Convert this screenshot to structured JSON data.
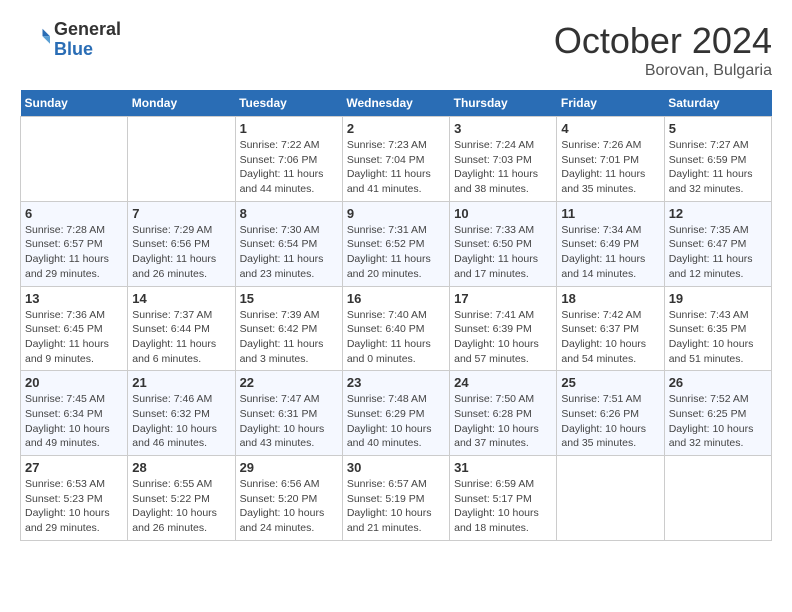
{
  "header": {
    "logo_general": "General",
    "logo_blue": "Blue",
    "month_title": "October 2024",
    "location": "Borovan, Bulgaria"
  },
  "weekdays": [
    "Sunday",
    "Monday",
    "Tuesday",
    "Wednesday",
    "Thursday",
    "Friday",
    "Saturday"
  ],
  "weeks": [
    [
      null,
      null,
      {
        "day": "1",
        "sunrise": "Sunrise: 7:22 AM",
        "sunset": "Sunset: 7:06 PM",
        "daylight": "Daylight: 11 hours and 44 minutes."
      },
      {
        "day": "2",
        "sunrise": "Sunrise: 7:23 AM",
        "sunset": "Sunset: 7:04 PM",
        "daylight": "Daylight: 11 hours and 41 minutes."
      },
      {
        "day": "3",
        "sunrise": "Sunrise: 7:24 AM",
        "sunset": "Sunset: 7:03 PM",
        "daylight": "Daylight: 11 hours and 38 minutes."
      },
      {
        "day": "4",
        "sunrise": "Sunrise: 7:26 AM",
        "sunset": "Sunset: 7:01 PM",
        "daylight": "Daylight: 11 hours and 35 minutes."
      },
      {
        "day": "5",
        "sunrise": "Sunrise: 7:27 AM",
        "sunset": "Sunset: 6:59 PM",
        "daylight": "Daylight: 11 hours and 32 minutes."
      }
    ],
    [
      {
        "day": "6",
        "sunrise": "Sunrise: 7:28 AM",
        "sunset": "Sunset: 6:57 PM",
        "daylight": "Daylight: 11 hours and 29 minutes."
      },
      {
        "day": "7",
        "sunrise": "Sunrise: 7:29 AM",
        "sunset": "Sunset: 6:56 PM",
        "daylight": "Daylight: 11 hours and 26 minutes."
      },
      {
        "day": "8",
        "sunrise": "Sunrise: 7:30 AM",
        "sunset": "Sunset: 6:54 PM",
        "daylight": "Daylight: 11 hours and 23 minutes."
      },
      {
        "day": "9",
        "sunrise": "Sunrise: 7:31 AM",
        "sunset": "Sunset: 6:52 PM",
        "daylight": "Daylight: 11 hours and 20 minutes."
      },
      {
        "day": "10",
        "sunrise": "Sunrise: 7:33 AM",
        "sunset": "Sunset: 6:50 PM",
        "daylight": "Daylight: 11 hours and 17 minutes."
      },
      {
        "day": "11",
        "sunrise": "Sunrise: 7:34 AM",
        "sunset": "Sunset: 6:49 PM",
        "daylight": "Daylight: 11 hours and 14 minutes."
      },
      {
        "day": "12",
        "sunrise": "Sunrise: 7:35 AM",
        "sunset": "Sunset: 6:47 PM",
        "daylight": "Daylight: 11 hours and 12 minutes."
      }
    ],
    [
      {
        "day": "13",
        "sunrise": "Sunrise: 7:36 AM",
        "sunset": "Sunset: 6:45 PM",
        "daylight": "Daylight: 11 hours and 9 minutes."
      },
      {
        "day": "14",
        "sunrise": "Sunrise: 7:37 AM",
        "sunset": "Sunset: 6:44 PM",
        "daylight": "Daylight: 11 hours and 6 minutes."
      },
      {
        "day": "15",
        "sunrise": "Sunrise: 7:39 AM",
        "sunset": "Sunset: 6:42 PM",
        "daylight": "Daylight: 11 hours and 3 minutes."
      },
      {
        "day": "16",
        "sunrise": "Sunrise: 7:40 AM",
        "sunset": "Sunset: 6:40 PM",
        "daylight": "Daylight: 11 hours and 0 minutes."
      },
      {
        "day": "17",
        "sunrise": "Sunrise: 7:41 AM",
        "sunset": "Sunset: 6:39 PM",
        "daylight": "Daylight: 10 hours and 57 minutes."
      },
      {
        "day": "18",
        "sunrise": "Sunrise: 7:42 AM",
        "sunset": "Sunset: 6:37 PM",
        "daylight": "Daylight: 10 hours and 54 minutes."
      },
      {
        "day": "19",
        "sunrise": "Sunrise: 7:43 AM",
        "sunset": "Sunset: 6:35 PM",
        "daylight": "Daylight: 10 hours and 51 minutes."
      }
    ],
    [
      {
        "day": "20",
        "sunrise": "Sunrise: 7:45 AM",
        "sunset": "Sunset: 6:34 PM",
        "daylight": "Daylight: 10 hours and 49 minutes."
      },
      {
        "day": "21",
        "sunrise": "Sunrise: 7:46 AM",
        "sunset": "Sunset: 6:32 PM",
        "daylight": "Daylight: 10 hours and 46 minutes."
      },
      {
        "day": "22",
        "sunrise": "Sunrise: 7:47 AM",
        "sunset": "Sunset: 6:31 PM",
        "daylight": "Daylight: 10 hours and 43 minutes."
      },
      {
        "day": "23",
        "sunrise": "Sunrise: 7:48 AM",
        "sunset": "Sunset: 6:29 PM",
        "daylight": "Daylight: 10 hours and 40 minutes."
      },
      {
        "day": "24",
        "sunrise": "Sunrise: 7:50 AM",
        "sunset": "Sunset: 6:28 PM",
        "daylight": "Daylight: 10 hours and 37 minutes."
      },
      {
        "day": "25",
        "sunrise": "Sunrise: 7:51 AM",
        "sunset": "Sunset: 6:26 PM",
        "daylight": "Daylight: 10 hours and 35 minutes."
      },
      {
        "day": "26",
        "sunrise": "Sunrise: 7:52 AM",
        "sunset": "Sunset: 6:25 PM",
        "daylight": "Daylight: 10 hours and 32 minutes."
      }
    ],
    [
      {
        "day": "27",
        "sunrise": "Sunrise: 6:53 AM",
        "sunset": "Sunset: 5:23 PM",
        "daylight": "Daylight: 10 hours and 29 minutes."
      },
      {
        "day": "28",
        "sunrise": "Sunrise: 6:55 AM",
        "sunset": "Sunset: 5:22 PM",
        "daylight": "Daylight: 10 hours and 26 minutes."
      },
      {
        "day": "29",
        "sunrise": "Sunrise: 6:56 AM",
        "sunset": "Sunset: 5:20 PM",
        "daylight": "Daylight: 10 hours and 24 minutes."
      },
      {
        "day": "30",
        "sunrise": "Sunrise: 6:57 AM",
        "sunset": "Sunset: 5:19 PM",
        "daylight": "Daylight: 10 hours and 21 minutes."
      },
      {
        "day": "31",
        "sunrise": "Sunrise: 6:59 AM",
        "sunset": "Sunset: 5:17 PM",
        "daylight": "Daylight: 10 hours and 18 minutes."
      },
      null,
      null
    ]
  ]
}
